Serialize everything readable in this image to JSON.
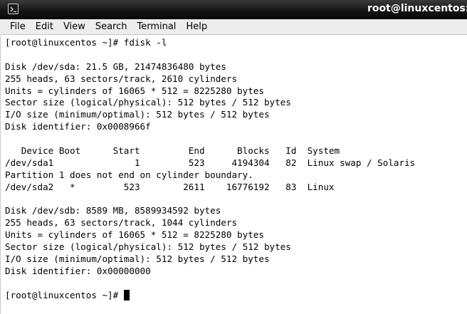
{
  "window": {
    "title": "root@linuxcentos:~",
    "icon": "terminal-icon"
  },
  "menu": {
    "items": [
      "File",
      "Edit",
      "View",
      "Search",
      "Terminal",
      "Help"
    ]
  },
  "terminal": {
    "lines": [
      "[root@linuxcentos ~]# fdisk -l",
      "",
      "Disk /dev/sda: 21.5 GB, 21474836480 bytes",
      "255 heads, 63 sectors/track, 2610 cylinders",
      "Units = cylinders of 16065 * 512 = 8225280 bytes",
      "Sector size (logical/physical): 512 bytes / 512 bytes",
      "I/O size (minimum/optimal): 512 bytes / 512 bytes",
      "Disk identifier: 0x0008966f",
      "",
      "   Device Boot      Start         End      Blocks   Id  System",
      "/dev/sda1               1         523     4194304   82  Linux swap / Solaris",
      "Partition 1 does not end on cylinder boundary.",
      "/dev/sda2   *         523        2611    16776192   83  Linux",
      "",
      "Disk /dev/sdb: 8589 MB, 8589934592 bytes",
      "255 heads, 63 sectors/track, 1044 cylinders",
      "Units = cylinders of 16065 * 512 = 8225280 bytes",
      "Sector size (logical/physical): 512 bytes / 512 bytes",
      "I/O size (minimum/optimal): 512 bytes / 512 bytes",
      "Disk identifier: 0x00000000",
      ""
    ],
    "prompt": "[root@linuxcentos ~]# "
  }
}
